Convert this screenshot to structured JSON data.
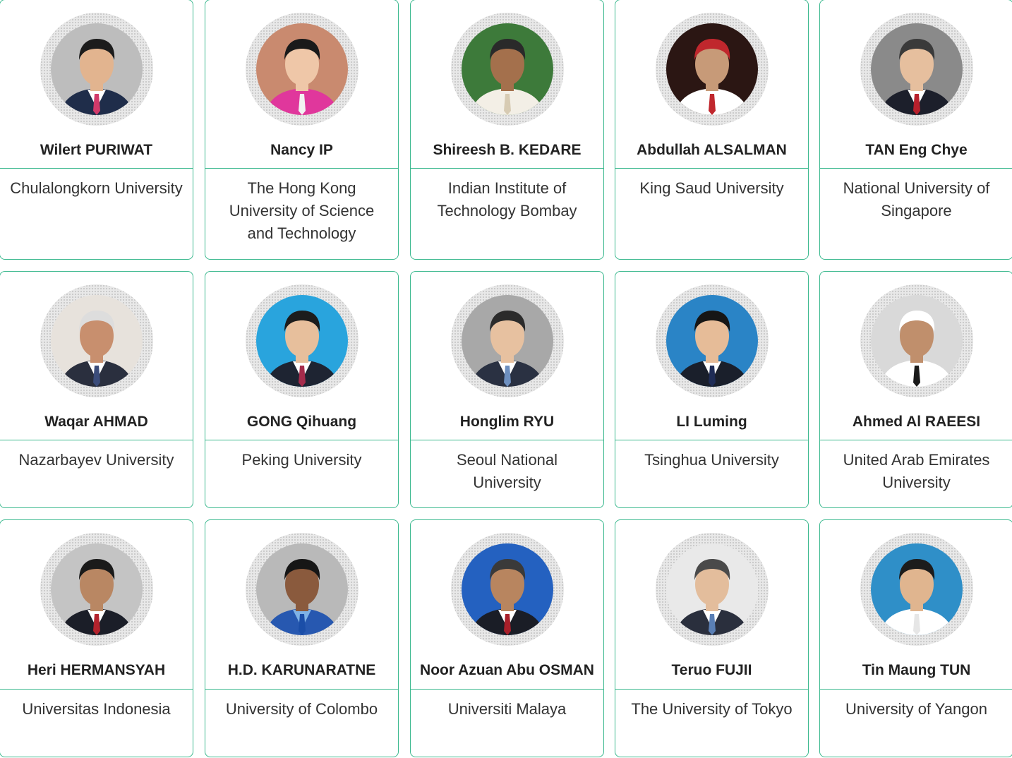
{
  "colors": {
    "border": "#3cb98f",
    "name_text": "#222222",
    "affiliation_text": "#333333"
  },
  "people": [
    {
      "name": "Wilert PURIWAT",
      "affiliation": "Chulalongkorn University",
      "icon": "person-photo",
      "bg": "#bdbdbd",
      "skin": "#e2b48f",
      "hair": "#1c1c1c",
      "suit": "#1f2d4a",
      "shirt": "#ffffff",
      "accent": "#d23a6a"
    },
    {
      "name": "Nancy IP",
      "affiliation": "The Hong Kong University of Science and Technology",
      "icon": "person-photo",
      "bg": "#c98a6f",
      "skin": "#efc7a8",
      "hair": "#1a1a1a",
      "suit": "#e0379c",
      "shirt": "#e0379c",
      "accent": "#f2f2f2"
    },
    {
      "name": "Shireesh B. KEDARE",
      "affiliation": "Indian Institute of Technology Bombay",
      "icon": "person-photo",
      "bg": "#3d7a3a",
      "skin": "#a4704c",
      "hair": "#2a2a2a",
      "suit": "#f3efe6",
      "shirt": "#f3efe6",
      "accent": "#d7cbb3"
    },
    {
      "name": "Abdullah ALSALMAN",
      "affiliation": "King Saud University",
      "icon": "person-photo",
      "bg": "#2b1613",
      "skin": "#c79a78",
      "hair": "#c0272d",
      "suit": "#ffffff",
      "shirt": "#ffffff",
      "accent": "#c0272d"
    },
    {
      "name": "TAN Eng Chye",
      "affiliation": "National University of Singapore",
      "icon": "person-photo",
      "bg": "#8a8a8a",
      "skin": "#e6bf9e",
      "hair": "#3a3a3a",
      "suit": "#1c1f2b",
      "shirt": "#ffffff",
      "accent": "#b8202c"
    },
    {
      "name": "Waqar AHMAD",
      "affiliation": "Nazarbayev University",
      "icon": "person-photo",
      "bg": "#e7e2dc",
      "skin": "#c88f6e",
      "hair": "#dddddd",
      "suit": "#2a2f3e",
      "shirt": "#ffffff",
      "accent": "#3b4c7a"
    },
    {
      "name": "GONG Qihuang",
      "affiliation": "Peking University",
      "icon": "person-photo",
      "bg": "#29a4dd",
      "skin": "#e7bf9c",
      "hair": "#1c1c1c",
      "suit": "#1e2432",
      "shirt": "#ffffff",
      "accent": "#a52b4b"
    },
    {
      "name": "Honglim RYU",
      "affiliation": "Seoul National University",
      "icon": "person-photo",
      "bg": "#a8a8a8",
      "skin": "#e7c1a0",
      "hair": "#2b2b2b",
      "suit": "#2a3142",
      "shirt": "#ffffff",
      "accent": "#6d8fbf"
    },
    {
      "name": "LI Luming",
      "affiliation": "Tsinghua University",
      "icon": "person-photo",
      "bg": "#2a84c6",
      "skin": "#e6bc98",
      "hair": "#161616",
      "suit": "#1a1f2b",
      "shirt": "#ffffff",
      "accent": "#1f2c56"
    },
    {
      "name": "Ahmed Al RAEESI",
      "affiliation": "United Arab Emirates University",
      "icon": "person-photo",
      "bg": "#d9d9d9",
      "skin": "#c08f6c",
      "hair": "#ffffff",
      "suit": "#ffffff",
      "shirt": "#ffffff",
      "accent": "#1a1a1a"
    },
    {
      "name": "Heri HERMANSYAH",
      "affiliation": "Universitas Indonesia",
      "icon": "person-photo",
      "bg": "#c4c4c4",
      "skin": "#b98763",
      "hair": "#1a1a1a",
      "suit": "#1b1e28",
      "shirt": "#ffffff",
      "accent": "#b3232d"
    },
    {
      "name": "H.D. KARUNARATNE",
      "affiliation": "University of Colombo",
      "icon": "person-photo",
      "bg": "#b9b9b9",
      "skin": "#8a5a3d",
      "hair": "#161616",
      "suit": "#2758b0",
      "shirt": "#7fb2e6",
      "accent": "#1b4ea8"
    },
    {
      "name": "Noor Azuan Abu OSMAN",
      "affiliation": "Universiti Malaya",
      "icon": "person-photo",
      "bg": "#2461c0",
      "skin": "#b8855f",
      "hair": "#3a3a3a",
      "suit": "#1a1d26",
      "shirt": "#ffffff",
      "accent": "#a81f2a"
    },
    {
      "name": "Teruo FUJII",
      "affiliation": "The University of Tokyo",
      "icon": "person-photo",
      "bg": "#e9e9e9",
      "skin": "#e3bd9c",
      "hair": "#4a4a4a",
      "suit": "#2a2f3d",
      "shirt": "#ffffff",
      "accent": "#5a7fb5"
    },
    {
      "name": "Tin Maung TUN",
      "affiliation": "University of Yangon",
      "icon": "person-photo",
      "bg": "#2f8fc8",
      "skin": "#e0b58f",
      "hair": "#1c1c1c",
      "suit": "#ffffff",
      "shirt": "#ffffff",
      "accent": "#e6e6e6"
    }
  ]
}
